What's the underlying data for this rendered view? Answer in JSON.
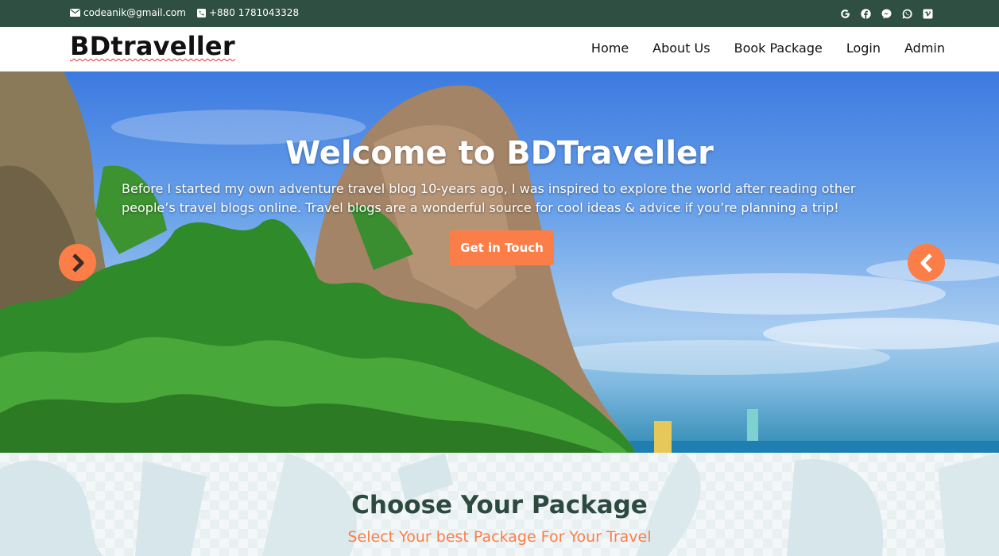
{
  "topbar": {
    "email": "codeanik@gmail.com",
    "phone": "+880 1781043328",
    "socials": [
      "google-icon",
      "facebook-icon",
      "messenger-icon",
      "whatsapp-icon",
      "vimeo-icon"
    ],
    "background": "#2f4f43"
  },
  "navbar": {
    "brand": "BDtraveller",
    "links": [
      "Home",
      "About Us",
      "Book Package",
      "Login",
      "Admin"
    ]
  },
  "hero": {
    "title": "Welcome to BDTraveller",
    "text": "Before I started my own adventure travel blog 10-years ago, I was inspired to explore the world after reading other people’s travel blogs online. Travel blogs are a wonderful source for cool ideas & advice if you’re planning a trip!",
    "cta": "Get in Touch",
    "accent": "#fb7e48"
  },
  "packages": {
    "title": "Choose Your Package",
    "subtitle": "Select Your best Package For Your Travel"
  }
}
